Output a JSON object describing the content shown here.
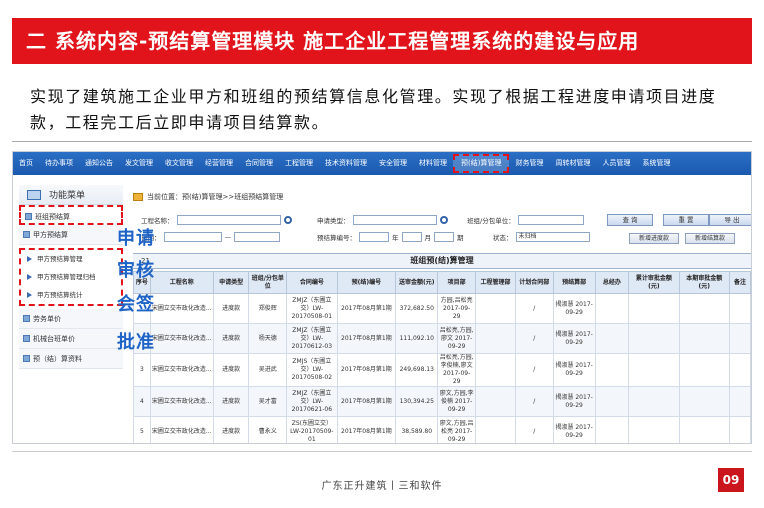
{
  "title": "二 系统内容-预结算管理模块    施工企业工程管理系统的建设与应用",
  "intro": "实现了建筑施工企业甲方和班组的预结算信息化管理。实现了根据工程进度申请项目进度款，工程完工后立即申请项目结算款。",
  "nav": [
    "首页",
    "待办事项",
    "通知公告",
    "发文管理",
    "收文管理",
    "经营管理",
    "合同管理",
    "工程管理",
    "技术资料管理",
    "安全管理",
    "材料管理",
    "预(结)算管理",
    "财务管理",
    "周转材管理",
    "人员管理",
    "系统管理"
  ],
  "menu": {
    "header": "功能菜单",
    "items": [
      "班组预结算",
      "甲方预结算"
    ],
    "sub_items": [
      "甲方预结算管理",
      "甲方预结算管理归档",
      "甲方预结算统计"
    ],
    "other_items": [
      "劳务单价",
      "机械台班单价",
      "预（结）算资料"
    ]
  },
  "overlay_words": [
    "申请",
    "审核",
    "会签",
    "批准"
  ],
  "breadcrumb": "当前位置：预(结)算管理>>班组预结算管理",
  "filters": {
    "project_name": "工程名称：",
    "apply_type": "申请类型：",
    "team_unit": "班组/分包单位：",
    "date": "日期：",
    "dash": "—",
    "code": "预结算编号：",
    "year": "年",
    "month": "月",
    "period": "期",
    "status": "状态：",
    "status_value": "未归档"
  },
  "buttons": {
    "query": "查 询",
    "reset": "重 置",
    "export": "导 出",
    "add_progress": "新增进度款",
    "add_settlement": "新增结算款"
  },
  "table": {
    "title": "班组预(结)算管理",
    "record_count": "21",
    "headers": [
      "序号",
      "工程名称",
      "申请类型",
      "班组/分包单位",
      "合同编号",
      "预(结)编号",
      "送审金额(元)",
      "项目部",
      "工程管理部",
      "计划合同部",
      "预结算部",
      "总经办",
      "累计审批金额(元)",
      "本期审批金额(元)",
      "备注"
    ],
    "rows": [
      {
        "no": "",
        "project": "宋圃立交市政化改造...",
        "type": "进度款",
        "team": "郑俊辉",
        "contract": "ZMJZ（东圃立交）LW-20170508-01",
        "code": "2017年08月第1期",
        "amount": "372,682.50",
        "dept": "方园,吕松亮 2017-09-29",
        "eng": "",
        "plan": "/",
        "budget": "揭淑慧 2017-09-29",
        "gm": "",
        "acc": "",
        "cur": "",
        "note": ""
      },
      {
        "no": "",
        "project": "宋圃立交市政化改造...",
        "type": "进度款",
        "team": "杨天德",
        "contract": "ZMJZ（东圃立交）LW-20170612-03",
        "code": "2017年08月第1期",
        "amount": "111,092.10",
        "dept": "吕松亮,方园,廖文 2017-09-29",
        "eng": "",
        "plan": "/",
        "budget": "揭淑慧 2017-09-29",
        "gm": "",
        "acc": "",
        "cur": "",
        "note": ""
      },
      {
        "no": "3",
        "project": "宋圃立交市政化改造...",
        "type": "进度款",
        "team": "吴进武",
        "contract": "ZMJS（东圃立交）LW-20170508-02",
        "code": "2017年08月第1期",
        "amount": "249,698.13",
        "dept": "吕松亮,方园,李俊楠,廖文 2017-09-29",
        "eng": "",
        "plan": "/",
        "budget": "揭淑慧 2017-09-29",
        "gm": "",
        "acc": "",
        "cur": "",
        "note": ""
      },
      {
        "no": "4",
        "project": "宋圃立交市政化改造...",
        "type": "进度款",
        "team": "吴才富",
        "contract": "ZMJZ（东圃立交）LW-20170621-06",
        "code": "2017年08月第1期",
        "amount": "130,394.25",
        "dept": "廖文,方园,李俊楠 2017-09-29",
        "eng": "",
        "plan": "/",
        "budget": "揭淑慧 2017-09-29",
        "gm": "",
        "acc": "",
        "cur": "",
        "note": ""
      },
      {
        "no": "5",
        "project": "宋圃立交市政化改造...",
        "type": "进度款",
        "team": "曹永义",
        "contract": "ZS(东圃立交）LW-20170509-01",
        "code": "2017年08月第1期",
        "amount": "38,589.80",
        "dept": "廖文,方园,吕松亮 2017-09-29",
        "eng": "",
        "plan": "/",
        "budget": "揭淑慧 2017-09-29",
        "gm": "",
        "acc": "",
        "cur": "",
        "note": ""
      }
    ]
  },
  "footer": "广东正升建筑丨三和软件",
  "page": "09",
  "colors": {
    "brand_red": "#e2141b",
    "nav_blue": "#1b5aae",
    "overlay_blue": "#1e63c6"
  }
}
